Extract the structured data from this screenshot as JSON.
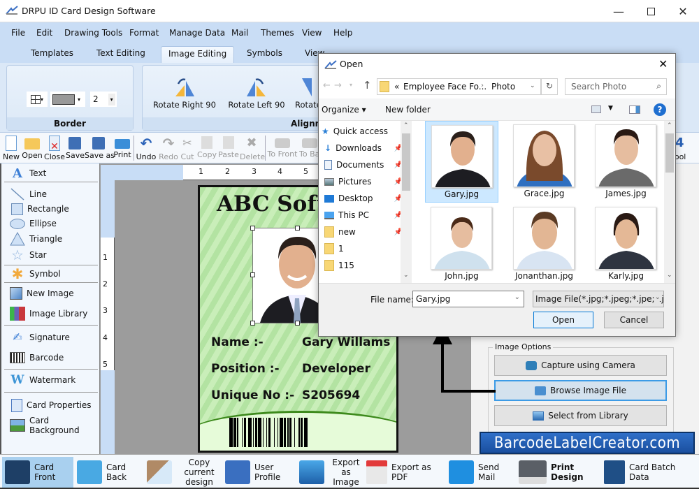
{
  "window": {
    "title": "DRPU ID Card Design Software",
    "minimize": "—",
    "maximize": "☐",
    "close": "✕"
  },
  "menu": [
    "File",
    "Edit",
    "Drawing Tools",
    "Format",
    "Manage Data",
    "Mail",
    "Themes",
    "View",
    "Help"
  ],
  "tabs": [
    {
      "label": "Templates",
      "active": false
    },
    {
      "label": "Text Editing",
      "active": false
    },
    {
      "label": "Image Editing",
      "active": true
    },
    {
      "label": "Symbols",
      "active": false
    },
    {
      "label": "View",
      "active": false
    }
  ],
  "ribbon": {
    "border_group": {
      "label": "Border",
      "line_width": "2"
    },
    "alignment_group": {
      "label": "Alignment",
      "buttons": [
        "Rotate Right 90",
        "Rotate Left 90",
        "Rotate"
      ]
    }
  },
  "toolbar": {
    "items": [
      {
        "label": "New",
        "icon": "new-file-icon",
        "enabled": true
      },
      {
        "label": "Open",
        "icon": "open-folder-icon",
        "enabled": true
      },
      {
        "label": "Close",
        "icon": "close-file-icon",
        "enabled": true
      },
      {
        "label": "Save",
        "icon": "save-icon",
        "enabled": true
      },
      {
        "label": "Save as",
        "icon": "save-as-icon",
        "enabled": true
      },
      {
        "label": "Print",
        "icon": "print-icon",
        "enabled": true
      },
      {
        "label": "Undo",
        "icon": "undo-icon",
        "enabled": true
      },
      {
        "label": "Redo",
        "icon": "redo-icon",
        "enabled": false
      },
      {
        "label": "Cut",
        "icon": "cut-icon",
        "enabled": false
      },
      {
        "label": "Copy",
        "icon": "copy-icon",
        "enabled": false
      },
      {
        "label": "Paste",
        "icon": "paste-icon",
        "enabled": false
      },
      {
        "label": "Delete",
        "icon": "delete-icon",
        "enabled": false
      },
      {
        "label": "To Front",
        "icon": "to-front-icon",
        "enabled": false
      },
      {
        "label": "To Back",
        "icon": "to-back-icon",
        "enabled": false
      }
    ],
    "right_label": "Tool"
  },
  "left_panel": [
    {
      "label": "Text",
      "icon": "text-icon"
    },
    {
      "label": "Line",
      "icon": "line-icon"
    },
    {
      "label": "Rectangle",
      "icon": "rectangle-icon"
    },
    {
      "label": "Ellipse",
      "icon": "ellipse-icon"
    },
    {
      "label": "Triangle",
      "icon": "triangle-icon"
    },
    {
      "label": "Star",
      "icon": "star-icon"
    },
    {
      "label": "Symbol",
      "icon": "symbol-icon"
    },
    {
      "label": "New Image",
      "icon": "new-image-icon"
    },
    {
      "label": "Image Library",
      "icon": "image-library-icon"
    },
    {
      "label": "Signature",
      "icon": "signature-icon"
    },
    {
      "label": "Barcode",
      "icon": "barcode-icon"
    },
    {
      "label": "Watermark",
      "icon": "watermark-icon"
    },
    {
      "label": "Card Properties",
      "icon": "card-properties-icon"
    },
    {
      "label": "Card Background",
      "icon": "card-background-icon"
    }
  ],
  "rulers": {
    "top": [
      "1",
      "2",
      "3",
      "4",
      "5"
    ],
    "left": [
      "1",
      "2",
      "3",
      "4",
      "5"
    ]
  },
  "card": {
    "title": "ABC Soft",
    "fields": [
      {
        "label": "Name :-",
        "value": "Gary Willams"
      },
      {
        "label": "Position :-",
        "value": "Developer"
      },
      {
        "label": "Unique No :-",
        "value": "S205694"
      }
    ],
    "colors": {
      "background": "#b3e3a2",
      "curve": "#3d8a1c",
      "bottom": "#e6fbd9"
    }
  },
  "image_options": {
    "legend": "Image Options",
    "buttons": [
      {
        "label": "Capture using Camera",
        "icon": "camera-icon"
      },
      {
        "label": "Browse Image File",
        "icon": "browse-folder-icon",
        "focused": true
      },
      {
        "label": "Select from Library",
        "icon": "library-image-icon"
      }
    ]
  },
  "brand": "BarcodeLabelCreator.com",
  "dialog": {
    "title": "Open",
    "path": [
      "Employee Face Fo...",
      "Photo"
    ],
    "path_prefix": "«",
    "search_placeholder": "Search Photo",
    "organize": "Organize ▾",
    "new_folder": "New folder",
    "nav": [
      {
        "label": "Quick access",
        "icon": "quick-access-star-icon",
        "pinned": false
      },
      {
        "label": "Downloads",
        "icon": "downloads-icon",
        "pinned": true
      },
      {
        "label": "Documents",
        "icon": "documents-icon",
        "pinned": true
      },
      {
        "label": "Pictures",
        "icon": "pictures-icon",
        "pinned": true
      },
      {
        "label": "Desktop",
        "icon": "desktop-icon",
        "pinned": true
      },
      {
        "label": "This PC",
        "icon": "this-pc-icon",
        "pinned": true
      },
      {
        "label": "new",
        "icon": "folder-icon",
        "pinned": true
      },
      {
        "label": "1",
        "icon": "folder-icon",
        "pinned": false
      },
      {
        "label": "115",
        "icon": "folder-icon",
        "pinned": false
      }
    ],
    "files": [
      {
        "name": "Gary.jpg",
        "selected": true
      },
      {
        "name": "Grace.jpg",
        "selected": false
      },
      {
        "name": "James.jpg",
        "selected": false
      },
      {
        "name": "John.jpg",
        "selected": false
      },
      {
        "name": "Jonanthan.jpg",
        "selected": false
      },
      {
        "name": "Karly.jpg",
        "selected": false
      }
    ],
    "file_name_label": "File name:",
    "file_name_value": "Gary.jpg",
    "file_type": "Image File(*.jpg;*.jpeg;*.jpe;*.jfi",
    "open_button": "Open",
    "cancel_button": "Cancel"
  },
  "bottom_bar": [
    {
      "label": "Card Front",
      "icon": "card-front-icon",
      "active": true,
      "bold": false
    },
    {
      "label": "Card Back",
      "icon": "card-back-icon",
      "active": false,
      "bold": false
    },
    {
      "label": "Copy current design",
      "icon": "copy-design-icon",
      "active": false,
      "bold": false
    },
    {
      "label": "User Profile",
      "icon": "user-profile-icon",
      "active": false,
      "bold": false
    },
    {
      "label": "Export as Image",
      "icon": "export-image-icon",
      "active": false,
      "bold": false
    },
    {
      "label": "Export as PDF",
      "icon": "export-pdf-icon",
      "active": false,
      "bold": false
    },
    {
      "label": "Send Mail",
      "icon": "send-mail-icon",
      "active": false,
      "bold": false
    },
    {
      "label": "Print Design",
      "icon": "print-design-icon",
      "active": false,
      "bold": true
    },
    {
      "label": "Card Batch Data",
      "icon": "card-batch-data-icon",
      "active": false,
      "bold": false
    }
  ]
}
